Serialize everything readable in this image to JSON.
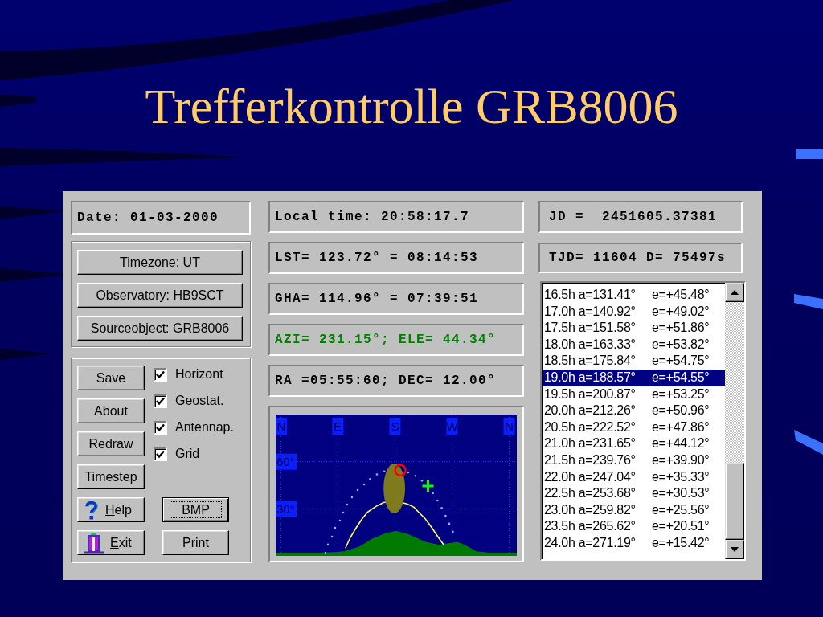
{
  "title": "Trefferkontrolle GRB8006",
  "window": {
    "left": {
      "date_field": "Date: 01-03-2000",
      "setup_buttons": [
        {
          "label": "Timezone: UT"
        },
        {
          "label": "Observatory: HB9SCT"
        },
        {
          "label": "Sourceobject: GRB8006"
        }
      ],
      "action_buttons": [
        {
          "label": "Save",
          "kind": "plain"
        },
        {
          "label": "About",
          "kind": "plain"
        },
        {
          "label": "Redraw",
          "kind": "plain"
        },
        {
          "label": "Timestep",
          "kind": "plain"
        },
        {
          "label": "Help",
          "kind": "help"
        },
        {
          "label": "Exit",
          "kind": "exit"
        }
      ],
      "options": [
        {
          "label": "Horizont",
          "checked": true
        },
        {
          "label": "Geostat.",
          "checked": true
        },
        {
          "label": "Antennap.",
          "checked": true
        },
        {
          "label": "Grid",
          "checked": true
        }
      ],
      "output_buttons": [
        {
          "label": "BMP",
          "focused": true
        },
        {
          "label": "Print",
          "focused": false
        }
      ]
    },
    "middle": {
      "readouts": [
        {
          "text": "Local time: 20:58:17.7",
          "color": "#000000"
        },
        {
          "text": "LST= 123.72° = 08:14:53",
          "color": "#000000"
        },
        {
          "text": "GHA= 114.96° = 07:39:51",
          "color": "#000000"
        },
        {
          "text": "AZI= 231.15°; ELE= 44.34°",
          "color": "#008000"
        },
        {
          "text": "RA =05:55:60; DEC= 12.00°",
          "color": "#000000"
        }
      ],
      "sky_map": {
        "direction_labels": [
          "N",
          "E",
          "S",
          "W",
          "N"
        ],
        "elevation_labels": [
          "60°",
          "30°"
        ]
      }
    },
    "right": {
      "readouts": [
        {
          "text": "JD =  2451605.37381"
        },
        {
          "text": "TJD= 11604 D= 75497s"
        }
      ],
      "track_list": {
        "rows": [
          {
            "time": "16.5h",
            "azimuth": "a=131.41°",
            "elevation": "e=+45.48°",
            "selected": false
          },
          {
            "time": "17.0h",
            "azimuth": "a=140.92°",
            "elevation": "e=+49.02°",
            "selected": false
          },
          {
            "time": "17.5h",
            "azimuth": "a=151.58°",
            "elevation": "e=+51.86°",
            "selected": false
          },
          {
            "time": "18.0h",
            "azimuth": "a=163.33°",
            "elevation": "e=+53.82°",
            "selected": false
          },
          {
            "time": "18.5h",
            "azimuth": "a=175.84°",
            "elevation": "e=+54.75°",
            "selected": false
          },
          {
            "time": "19.0h",
            "azimuth": "a=188.57°",
            "elevation": "e=+54.55°",
            "selected": true
          },
          {
            "time": "19.5h",
            "azimuth": "a=200.87°",
            "elevation": "e=+53.25°",
            "selected": false
          },
          {
            "time": "20.0h",
            "azimuth": "a=212.26°",
            "elevation": "e=+50.96°",
            "selected": false
          },
          {
            "time": "20.5h",
            "azimuth": "a=222.52°",
            "elevation": "e=+47.86°",
            "selected": false
          },
          {
            "time": "21.0h",
            "azimuth": "a=231.65°",
            "elevation": "e=+44.12°",
            "selected": false
          },
          {
            "time": "21.5h",
            "azimuth": "a=239.76°",
            "elevation": "e=+39.90°",
            "selected": false
          },
          {
            "time": "22.0h",
            "azimuth": "a=247.04°",
            "elevation": "e=+35.33°",
            "selected": false
          },
          {
            "time": "22.5h",
            "azimuth": "a=253.68°",
            "elevation": "e=+30.53°",
            "selected": false
          },
          {
            "time": "23.0h",
            "azimuth": "a=259.82°",
            "elevation": "e=+25.56°",
            "selected": false
          },
          {
            "time": "23.5h",
            "azimuth": "a=265.62°",
            "elevation": "e=+20.51°",
            "selected": false
          },
          {
            "time": "24.0h",
            "azimuth": "a=271.19°",
            "elevation": "e=+15.42°",
            "selected": false
          }
        ]
      }
    }
  }
}
